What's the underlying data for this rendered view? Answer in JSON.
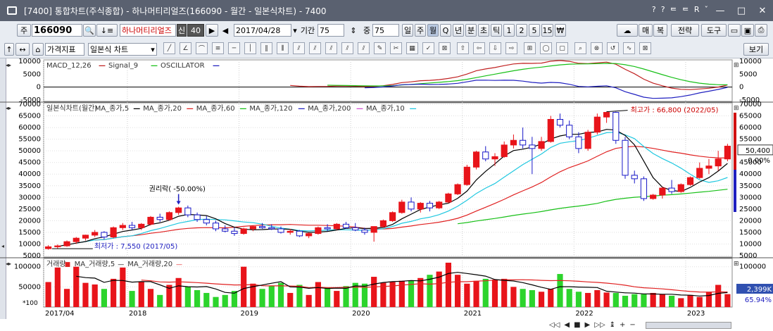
{
  "window": {
    "title": "[7400] 통합차트(주식종합) - 하나머티리얼즈(166090 - 월간 - 일본식차트) - 7400",
    "title_icons": [
      "?",
      "?",
      "ᄐ",
      "ᄐ",
      "R",
      "ˇ"
    ],
    "minimize": "—",
    "maximize": "□",
    "close": "✕"
  },
  "toolbar1": {
    "market_label": "주",
    "code_value": "166090",
    "stock_name": "하나머티리얼즈",
    "badge_credit": "신",
    "badge_rate": "40",
    "date_value": "2017/04/28",
    "period_label": "기간",
    "period_value": "75",
    "count_label": "중",
    "count_value": "75",
    "intervals": [
      "일",
      "주",
      "월",
      "Q",
      "년",
      "분",
      "초",
      "틱",
      "1",
      "2",
      "5",
      "15",
      "₩"
    ],
    "active_interval": "월",
    "right_buttons": [
      "매",
      "복",
      "전략",
      "도구"
    ]
  },
  "toolbar2": {
    "indicator_select": "가격지표",
    "chart_type_select": "일본식 차트",
    "view_button": "보기"
  },
  "chart_data": {
    "type": "candlestick",
    "periods": [
      {
        "label": "2017/04",
        "open": 8000,
        "high": 9500,
        "low": 7550,
        "close": 8800
      },
      {
        "label": "2017/05",
        "open": 8800,
        "high": 9800,
        "low": 8000,
        "close": 9200
      },
      {
        "label": "2017/06",
        "open": 9200,
        "high": 11500,
        "low": 8800,
        "close": 11000
      },
      {
        "label": "2017/07",
        "open": 11000,
        "high": 13000,
        "low": 10000,
        "close": 12500
      },
      {
        "label": "2017/08",
        "open": 12500,
        "high": 14000,
        "low": 11500,
        "close": 13800
      },
      {
        "label": "2017/09",
        "open": 13800,
        "high": 16000,
        "low": 13000,
        "close": 15000
      },
      {
        "label": "2017/10",
        "open": 15000,
        "high": 15500,
        "low": 12000,
        "close": 13000
      },
      {
        "label": "2017/11",
        "open": 13000,
        "high": 17500,
        "low": 12500,
        "close": 17000
      },
      {
        "label": "2017/12",
        "open": 17000,
        "high": 19000,
        "low": 16000,
        "close": 18000
      },
      {
        "label": "2018/01",
        "open": 18000,
        "high": 19500,
        "low": 16000,
        "close": 17000
      },
      {
        "label": "2018/02",
        "open": 17000,
        "high": 19000,
        "low": 16000,
        "close": 18500
      },
      {
        "label": "2018/03",
        "open": 18500,
        "high": 22000,
        "low": 18000,
        "close": 21500
      },
      {
        "label": "2018/04",
        "open": 21500,
        "high": 23000,
        "low": 19500,
        "close": 20500
      },
      {
        "label": "2018/05",
        "open": 20500,
        "high": 24000,
        "low": 20000,
        "close": 23500
      },
      {
        "label": "2018/06",
        "open": 23500,
        "high": 26000,
        "low": 22500,
        "close": 25500
      },
      {
        "label": "2018/07",
        "open": 25500,
        "high": 26500,
        "low": 21500,
        "close": 22500
      },
      {
        "label": "2018/08",
        "open": 22500,
        "high": 23500,
        "low": 19500,
        "close": 20500
      },
      {
        "label": "2018/09",
        "open": 20500,
        "high": 22000,
        "low": 18000,
        "close": 19000
      },
      {
        "label": "2018/10",
        "open": 19000,
        "high": 20000,
        "low": 15500,
        "close": 16500
      },
      {
        "label": "2018/11",
        "open": 16500,
        "high": 18000,
        "low": 15000,
        "close": 15500
      },
      {
        "label": "2018/12",
        "open": 15500,
        "high": 17000,
        "low": 13500,
        "close": 14500
      },
      {
        "label": "2019/01",
        "open": 14500,
        "high": 17000,
        "low": 14000,
        "close": 16500
      },
      {
        "label": "2019/02",
        "open": 16500,
        "high": 18000,
        "low": 15500,
        "close": 17500
      },
      {
        "label": "2019/03",
        "open": 17500,
        "high": 19000,
        "low": 16500,
        "close": 17000
      },
      {
        "label": "2019/04",
        "open": 17000,
        "high": 18500,
        "low": 16000,
        "close": 16500
      },
      {
        "label": "2019/05",
        "open": 16500,
        "high": 17500,
        "low": 14500,
        "close": 15000
      },
      {
        "label": "2019/06",
        "open": 15000,
        "high": 16500,
        "low": 14000,
        "close": 15500
      },
      {
        "label": "2019/07",
        "open": 15500,
        "high": 16000,
        "low": 13000,
        "close": 13500
      },
      {
        "label": "2019/08",
        "open": 13500,
        "high": 15000,
        "low": 12500,
        "close": 14500
      },
      {
        "label": "2019/09",
        "open": 14500,
        "high": 17500,
        "low": 14000,
        "close": 17000
      },
      {
        "label": "2019/10",
        "open": 17000,
        "high": 18500,
        "low": 15500,
        "close": 16500
      },
      {
        "label": "2019/11",
        "open": 16500,
        "high": 19000,
        "low": 16000,
        "close": 18500
      },
      {
        "label": "2019/12",
        "open": 18500,
        "high": 19500,
        "low": 16500,
        "close": 17000
      },
      {
        "label": "2020/01",
        "open": 17000,
        "high": 19000,
        "low": 15500,
        "close": 16000
      },
      {
        "label": "2020/02",
        "open": 16000,
        "high": 17000,
        "low": 14000,
        "close": 15000
      },
      {
        "label": "2020/03",
        "open": 15000,
        "high": 16000,
        "low": 11000,
        "close": 17500
      },
      {
        "label": "2020/04",
        "open": 17500,
        "high": 20500,
        "low": 17000,
        "close": 20000
      },
      {
        "label": "2020/05",
        "open": 20000,
        "high": 24000,
        "low": 19500,
        "close": 23500
      },
      {
        "label": "2020/06",
        "open": 23500,
        "high": 29000,
        "low": 23000,
        "close": 28000
      },
      {
        "label": "2020/07",
        "open": 28000,
        "high": 30000,
        "low": 24000,
        "close": 25000
      },
      {
        "label": "2020/08",
        "open": 25000,
        "high": 28000,
        "low": 23500,
        "close": 27500
      },
      {
        "label": "2020/09",
        "open": 27500,
        "high": 28500,
        "low": 24000,
        "close": 25500
      },
      {
        "label": "2020/10",
        "open": 25500,
        "high": 28500,
        "low": 25000,
        "close": 28000
      },
      {
        "label": "2020/11",
        "open": 28000,
        "high": 32000,
        "low": 27500,
        "close": 31500
      },
      {
        "label": "2020/12",
        "open": 31500,
        "high": 36000,
        "low": 31000,
        "close": 35500
      },
      {
        "label": "2021/01",
        "open": 35500,
        "high": 44000,
        "low": 35000,
        "close": 43000
      },
      {
        "label": "2021/02",
        "open": 43000,
        "high": 50000,
        "low": 42000,
        "close": 49500
      },
      {
        "label": "2021/03",
        "open": 49500,
        "high": 52000,
        "low": 45500,
        "close": 46500
      },
      {
        "label": "2021/04",
        "open": 46500,
        "high": 49000,
        "low": 43500,
        "close": 47500
      },
      {
        "label": "2021/05",
        "open": 47500,
        "high": 54000,
        "low": 47000,
        "close": 52500
      },
      {
        "label": "2021/06",
        "open": 52500,
        "high": 57000,
        "low": 51000,
        "close": 54500
      },
      {
        "label": "2021/07",
        "open": 54500,
        "high": 60000,
        "low": 51000,
        "close": 52500
      },
      {
        "label": "2021/08",
        "open": 52500,
        "high": 56000,
        "low": 40000,
        "close": 51000
      },
      {
        "label": "2021/09",
        "open": 51000,
        "high": 56000,
        "low": 50000,
        "close": 54000
      },
      {
        "label": "2021/10",
        "open": 54000,
        "high": 65000,
        "low": 53500,
        "close": 63500
      },
      {
        "label": "2021/11",
        "open": 63500,
        "high": 66000,
        "low": 60000,
        "close": 61000
      },
      {
        "label": "2021/12",
        "open": 61000,
        "high": 63000,
        "low": 55000,
        "close": 56000
      },
      {
        "label": "2022/01",
        "open": 56000,
        "high": 58000,
        "low": 49000,
        "close": 51000
      },
      {
        "label": "2022/02",
        "open": 51000,
        "high": 59000,
        "low": 50000,
        "close": 58000
      },
      {
        "label": "2022/03",
        "open": 58000,
        "high": 66000,
        "low": 57000,
        "close": 64500
      },
      {
        "label": "2022/04",
        "open": 64500,
        "high": 66800,
        "low": 62000,
        "close": 66500
      },
      {
        "label": "2022/05",
        "open": 66500,
        "high": 66800,
        "low": 53000,
        "close": 54500
      },
      {
        "label": "2022/06",
        "open": 54500,
        "high": 56000,
        "low": 38000,
        "close": 39500
      },
      {
        "label": "2022/07",
        "open": 39500,
        "high": 41500,
        "low": 36000,
        "close": 38000
      },
      {
        "label": "2022/08",
        "open": 38000,
        "high": 39000,
        "low": 28500,
        "close": 29500
      },
      {
        "label": "2022/09",
        "open": 29500,
        "high": 31500,
        "low": 29000,
        "close": 31000
      },
      {
        "label": "2022/10",
        "open": 31000,
        "high": 34500,
        "low": 29500,
        "close": 34000
      },
      {
        "label": "2022/11",
        "open": 34000,
        "high": 37500,
        "low": 31500,
        "close": 32500
      },
      {
        "label": "2022/12",
        "open": 32500,
        "high": 36000,
        "low": 32000,
        "close": 35500
      },
      {
        "label": "2023/01",
        "open": 35500,
        "high": 39000,
        "low": 35000,
        "close": 38500
      },
      {
        "label": "2023/02",
        "open": 38500,
        "high": 45000,
        "low": 38000,
        "close": 42500
      },
      {
        "label": "2023/03",
        "open": 42500,
        "high": 46500,
        "low": 40000,
        "close": 43500
      },
      {
        "label": "2023/04",
        "open": 43500,
        "high": 50000,
        "low": 41500,
        "close": 46500
      },
      {
        "label": "2023/05",
        "open": 46500,
        "high": 53000,
        "low": 45500,
        "close": 52000
      }
    ],
    "volumes": [
      62000,
      98000,
      45000,
      100000,
      60000,
      56000,
      45000,
      70000,
      98000,
      40000,
      62000,
      45000,
      30000,
      55000,
      72000,
      50000,
      42000,
      35000,
      25000,
      30000,
      40000,
      100000,
      58000,
      45000,
      52000,
      60000,
      35000,
      55000,
      30000,
      62000,
      48000,
      40000,
      52000,
      60000,
      58000,
      75000,
      60000,
      62000,
      65000,
      66000,
      72000,
      80000,
      88000,
      110000,
      80000,
      58000,
      65000,
      70000,
      68000,
      70000,
      50000,
      45000,
      42000,
      38000,
      45000,
      82000,
      45000,
      38000,
      35000,
      42000,
      36000,
      35000,
      28000,
      32000,
      32000,
      35000,
      32000,
      28000,
      22000,
      30000,
      25000,
      38000,
      55000,
      32000
    ],
    "price_axis": {
      "min": 5000,
      "max": 70000,
      "ticks": [
        5000,
        10000,
        15000,
        20000,
        25000,
        30000,
        35000,
        40000,
        45000,
        50000,
        55000,
        60000,
        65000,
        70000
      ]
    },
    "volume_axis": {
      "min": 0,
      "max": 110000,
      "ticks": [
        50000,
        100000
      ]
    },
    "macd_axis": {
      "min": -5000,
      "max": 10000,
      "ticks": [
        -5000,
        0,
        5000,
        10000
      ]
    },
    "year_labels": [
      {
        "label": "2017/04",
        "index": 0
      },
      {
        "label": "2018",
        "index": 9
      },
      {
        "label": "2019",
        "index": 21
      },
      {
        "label": "2020",
        "index": 33
      },
      {
        "label": "2021",
        "index": 45
      },
      {
        "label": "2022",
        "index": 57
      },
      {
        "label": "2023",
        "index": 69
      }
    ],
    "price_legend": [
      {
        "text": "일본식차트(월간)",
        "color": "#000000",
        "marker": ""
      },
      {
        "text": "MA_종가,5",
        "color": "#000000",
        "marker": "—"
      },
      {
        "text": "MA_종가,20",
        "color": "#e02020",
        "marker": "—"
      },
      {
        "text": "MA_종가,60",
        "color": "#18c018",
        "marker": "—"
      },
      {
        "text": "MA_종가,120",
        "color": "#2020c0",
        "marker": "—"
      },
      {
        "text": "MA_종가,200",
        "color": "#d050d0",
        "marker": "—"
      },
      {
        "text": "MA_종가,10",
        "color": "#20c8e0",
        "marker": "—"
      }
    ],
    "macd_legend": [
      {
        "text": "MACD_12,26",
        "color": "#c02020",
        "marker": "—"
      },
      {
        "text": "Signal_9",
        "color": "#18c018",
        "marker": "—"
      },
      {
        "text": "OSCILLATOR",
        "color": "#2020c0",
        "marker": "—"
      }
    ],
    "volume_legend": [
      {
        "text": "거래량",
        "color": "#e02020",
        "marker": "■"
      },
      {
        "text": "MA_거래량,5",
        "color": "#000000",
        "marker": "—"
      },
      {
        "text": "MA_거래량,20",
        "color": "#e02020",
        "marker": "—"
      }
    ],
    "annotations": {
      "high": "최고가 : 66,800 (2022/05)",
      "low": "최저가 : 7,550 (2017/05)",
      "rights": "권리락( -50.00%)"
    },
    "right_panel": {
      "last_price": "50,400",
      "change_pct": "0.00%",
      "last_volume": "2,399K",
      "volume_pct": "65.94%"
    },
    "volume_scale_label": "*100",
    "colors": {
      "up": "#e8141a",
      "down": "#1818c8",
      "volume_down": "#2cd42c"
    }
  },
  "bottom_controls": [
    "◁◁",
    "◀",
    "■",
    "▶",
    "▷▷",
    "↨",
    "+",
    "−"
  ]
}
